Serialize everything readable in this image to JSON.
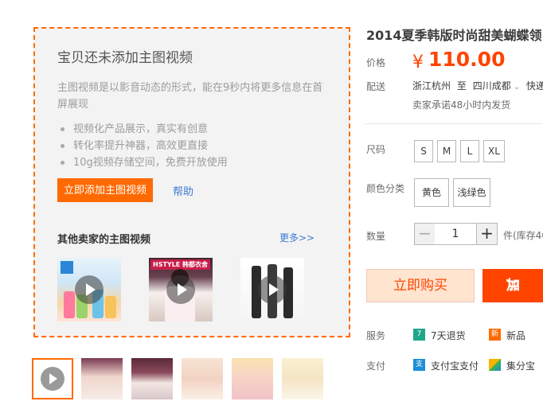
{
  "video_panel": {
    "title": "宝贝还未添加主图视频",
    "description": "主图视频是以影音动态的形式，能在9秒内将更多信息在首屏展现",
    "bullets": [
      "视频化产品展示，真实有创意",
      "转化率提升神器，高效更直接",
      "10g视频存储空间，免费开放使用"
    ],
    "add_button_label": "立即添加主图视频",
    "help_label": "帮助",
    "other_sellers_title": "其他卖家的主图视频",
    "more_label": "更多>>",
    "thumb_brands": [
      "",
      "HSTYLE 韩都衣舍",
      ""
    ]
  },
  "product": {
    "title": "2014夏季韩版时尚甜美蝴蝶领",
    "price_label": "价格",
    "price_symbol": "¥",
    "price_value": "110.00",
    "delivery_label": "配送",
    "ship_from": "浙江杭州",
    "ship_to_word": "至",
    "ship_to": "四川成都",
    "ship_speed": "快递",
    "promise": "卖家承诺48小时内发货",
    "size_label": "尺码",
    "sizes": [
      "S",
      "M",
      "L",
      "XL"
    ],
    "color_label": "颜色分类",
    "colors": [
      "黄色",
      "浅绿色"
    ],
    "quantity_label": "数量",
    "quantity_minus": "−",
    "quantity_value": "1",
    "quantity_plus": "+",
    "stock_text": "件(库存40",
    "buy_now_label": "立即购买",
    "add_cart_label": "加",
    "service_label": "服务",
    "services": [
      "7天退货",
      "新品"
    ],
    "service_icons": [
      "7",
      "新"
    ],
    "pay_label": "支付",
    "payments": [
      "支付宝支付",
      "集分宝"
    ],
    "payment_icons": [
      "支",
      ""
    ]
  },
  "colors": {
    "accent": "#ff6a00",
    "price": "#ff4400",
    "link": "#3a7bd5"
  }
}
